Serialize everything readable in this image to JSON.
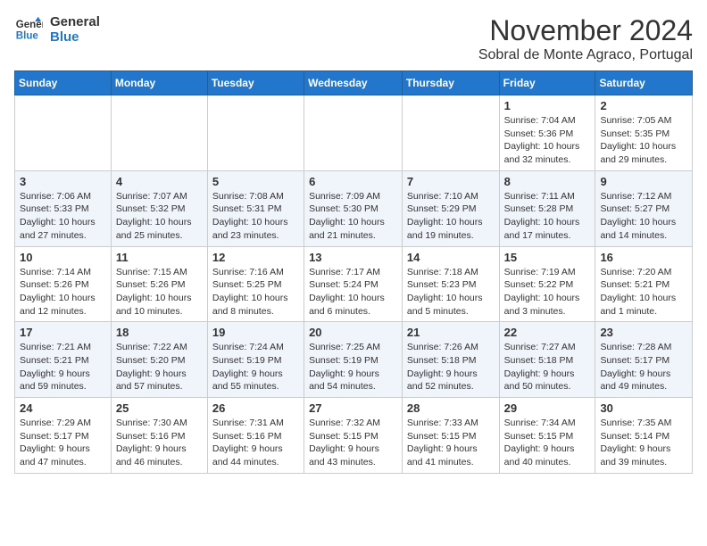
{
  "logo": {
    "line1": "General",
    "line2": "Blue"
  },
  "header": {
    "month": "November 2024",
    "location": "Sobral de Monte Agraco, Portugal"
  },
  "weekdays": [
    "Sunday",
    "Monday",
    "Tuesday",
    "Wednesday",
    "Thursday",
    "Friday",
    "Saturday"
  ],
  "weeks": [
    [
      {
        "day": "",
        "info": ""
      },
      {
        "day": "",
        "info": ""
      },
      {
        "day": "",
        "info": ""
      },
      {
        "day": "",
        "info": ""
      },
      {
        "day": "",
        "info": ""
      },
      {
        "day": "1",
        "info": "Sunrise: 7:04 AM\nSunset: 5:36 PM\nDaylight: 10 hours and 32 minutes."
      },
      {
        "day": "2",
        "info": "Sunrise: 7:05 AM\nSunset: 5:35 PM\nDaylight: 10 hours and 29 minutes."
      }
    ],
    [
      {
        "day": "3",
        "info": "Sunrise: 7:06 AM\nSunset: 5:33 PM\nDaylight: 10 hours and 27 minutes."
      },
      {
        "day": "4",
        "info": "Sunrise: 7:07 AM\nSunset: 5:32 PM\nDaylight: 10 hours and 25 minutes."
      },
      {
        "day": "5",
        "info": "Sunrise: 7:08 AM\nSunset: 5:31 PM\nDaylight: 10 hours and 23 minutes."
      },
      {
        "day": "6",
        "info": "Sunrise: 7:09 AM\nSunset: 5:30 PM\nDaylight: 10 hours and 21 minutes."
      },
      {
        "day": "7",
        "info": "Sunrise: 7:10 AM\nSunset: 5:29 PM\nDaylight: 10 hours and 19 minutes."
      },
      {
        "day": "8",
        "info": "Sunrise: 7:11 AM\nSunset: 5:28 PM\nDaylight: 10 hours and 17 minutes."
      },
      {
        "day": "9",
        "info": "Sunrise: 7:12 AM\nSunset: 5:27 PM\nDaylight: 10 hours and 14 minutes."
      }
    ],
    [
      {
        "day": "10",
        "info": "Sunrise: 7:14 AM\nSunset: 5:26 PM\nDaylight: 10 hours and 12 minutes."
      },
      {
        "day": "11",
        "info": "Sunrise: 7:15 AM\nSunset: 5:26 PM\nDaylight: 10 hours and 10 minutes."
      },
      {
        "day": "12",
        "info": "Sunrise: 7:16 AM\nSunset: 5:25 PM\nDaylight: 10 hours and 8 minutes."
      },
      {
        "day": "13",
        "info": "Sunrise: 7:17 AM\nSunset: 5:24 PM\nDaylight: 10 hours and 6 minutes."
      },
      {
        "day": "14",
        "info": "Sunrise: 7:18 AM\nSunset: 5:23 PM\nDaylight: 10 hours and 5 minutes."
      },
      {
        "day": "15",
        "info": "Sunrise: 7:19 AM\nSunset: 5:22 PM\nDaylight: 10 hours and 3 minutes."
      },
      {
        "day": "16",
        "info": "Sunrise: 7:20 AM\nSunset: 5:21 PM\nDaylight: 10 hours and 1 minute."
      }
    ],
    [
      {
        "day": "17",
        "info": "Sunrise: 7:21 AM\nSunset: 5:21 PM\nDaylight: 9 hours and 59 minutes."
      },
      {
        "day": "18",
        "info": "Sunrise: 7:22 AM\nSunset: 5:20 PM\nDaylight: 9 hours and 57 minutes."
      },
      {
        "day": "19",
        "info": "Sunrise: 7:24 AM\nSunset: 5:19 PM\nDaylight: 9 hours and 55 minutes."
      },
      {
        "day": "20",
        "info": "Sunrise: 7:25 AM\nSunset: 5:19 PM\nDaylight: 9 hours and 54 minutes."
      },
      {
        "day": "21",
        "info": "Sunrise: 7:26 AM\nSunset: 5:18 PM\nDaylight: 9 hours and 52 minutes."
      },
      {
        "day": "22",
        "info": "Sunrise: 7:27 AM\nSunset: 5:18 PM\nDaylight: 9 hours and 50 minutes."
      },
      {
        "day": "23",
        "info": "Sunrise: 7:28 AM\nSunset: 5:17 PM\nDaylight: 9 hours and 49 minutes."
      }
    ],
    [
      {
        "day": "24",
        "info": "Sunrise: 7:29 AM\nSunset: 5:17 PM\nDaylight: 9 hours and 47 minutes."
      },
      {
        "day": "25",
        "info": "Sunrise: 7:30 AM\nSunset: 5:16 PM\nDaylight: 9 hours and 46 minutes."
      },
      {
        "day": "26",
        "info": "Sunrise: 7:31 AM\nSunset: 5:16 PM\nDaylight: 9 hours and 44 minutes."
      },
      {
        "day": "27",
        "info": "Sunrise: 7:32 AM\nSunset: 5:15 PM\nDaylight: 9 hours and 43 minutes."
      },
      {
        "day": "28",
        "info": "Sunrise: 7:33 AM\nSunset: 5:15 PM\nDaylight: 9 hours and 41 minutes."
      },
      {
        "day": "29",
        "info": "Sunrise: 7:34 AM\nSunset: 5:15 PM\nDaylight: 9 hours and 40 minutes."
      },
      {
        "day": "30",
        "info": "Sunrise: 7:35 AM\nSunset: 5:14 PM\nDaylight: 9 hours and 39 minutes."
      }
    ]
  ]
}
